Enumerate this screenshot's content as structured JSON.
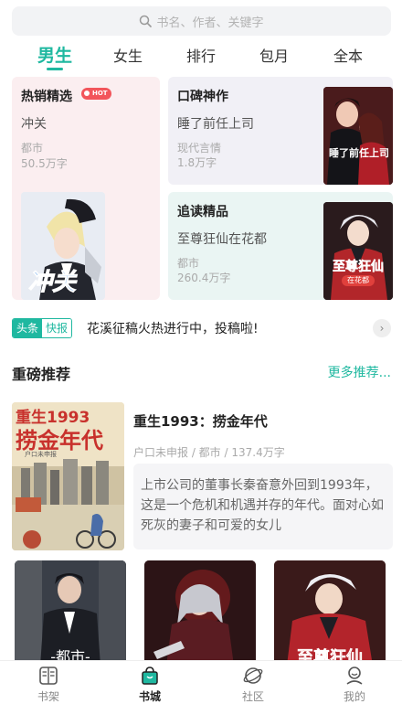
{
  "search": {
    "placeholder": "书名、作者、关键字"
  },
  "tabs": [
    "男生",
    "女生",
    "排行",
    "包月",
    "全本"
  ],
  "active_tab": "男生",
  "cards": {
    "hot": {
      "title": "热销精选",
      "badge": "HOT",
      "book": "冲关",
      "genre": "都市",
      "words": "50.5万字"
    },
    "praise": {
      "title": "口碑神作",
      "book": "睡了前任上司",
      "genre": "现代言情",
      "words": "1.8万字"
    },
    "follow": {
      "title": "追读精品",
      "book": "至尊狂仙在花都",
      "genre": "都市",
      "words": "260.4万字"
    }
  },
  "covers": {
    "hot_cover_text": "冲关",
    "praise_cover_text": "睡了前任上司",
    "follow_cover_text": "至尊狂仙",
    "follow_cover_subtitle": "在花都",
    "featured_cover_text": "重生1993",
    "featured_cover_text2": "捞金年代",
    "featured_cover_author": "户口未申报",
    "row1_text": "-都市-",
    "row3_text": "至尊狂仙"
  },
  "news": {
    "tag_left": "头条",
    "tag_right": "快报",
    "text": "花溪征稿火热进行中，投稿啦!",
    "arrow": "›"
  },
  "section": {
    "title": "重磅推荐",
    "more": "更多推荐..."
  },
  "featured": {
    "title": "重生1993：捞金年代",
    "meta": "户口未申报 / 都市 / 137.4万字",
    "desc": "上市公司的董事长秦奋意外回到1993年，这是一个危机和机遇并存的年代。面对心如死灰的妻子和可爱的女儿"
  },
  "bottom_nav": [
    {
      "label": "书架",
      "icon": "bookshelf-icon"
    },
    {
      "label": "书城",
      "icon": "bookstore-icon"
    },
    {
      "label": "社区",
      "icon": "community-icon"
    },
    {
      "label": "我的",
      "icon": "profile-icon"
    }
  ],
  "colors": {
    "accent": "#1fb8a0",
    "hot_badge": "#f2555b"
  }
}
